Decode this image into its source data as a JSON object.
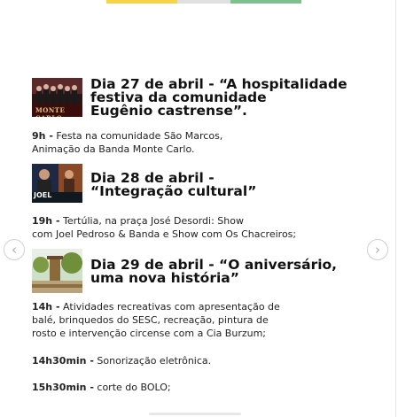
{
  "days": [
    {
      "title_l1": "Dia 27 de abril - “A hospitalidade",
      "title_l2": "festiva da comunidade",
      "title_l3": "Eugênio castrense”.",
      "thumb_caption": "MONTE CARLO",
      "time": "9h -",
      "text_l1": " Festa na comunidade São Marcos,",
      "text_l2": "Animação da Banda Monte Carlo."
    },
    {
      "title_l1": "Dia 28 de abril -",
      "title_l2": "“Integração cultural”",
      "thumb_caption": "JOEL",
      "time": "19h -",
      "text_l1": " Tertúlia, na praça José Desordi: Show",
      "text_l2": "com Joel Pedroso & Banda e Show com Os Chacreiros;"
    },
    {
      "title_l1": "Dia 29 de abril - “O aniversário,",
      "title_l2": "uma nova história”",
      "activities": [
        {
          "time": "14h -",
          "lines": [
            " Atividades recreativas com apresentação de",
            "balé, brinquedos do SESC, recreação, pintura de",
            "rosto e intervenção circense com a Cia Burzum;"
          ]
        },
        {
          "time": "14h30min -",
          "lines": [
            " Sonorização eletrônica."
          ]
        },
        {
          "time": "15h30min -",
          "lines": [
            " corte do BOLO;"
          ]
        }
      ]
    }
  ],
  "nav": {
    "prev_glyph": "‹",
    "next_glyph": "›"
  },
  "colors": {
    "accent_strip": [
      "#f2b600",
      "#c8102e",
      "#2e8b57"
    ]
  }
}
